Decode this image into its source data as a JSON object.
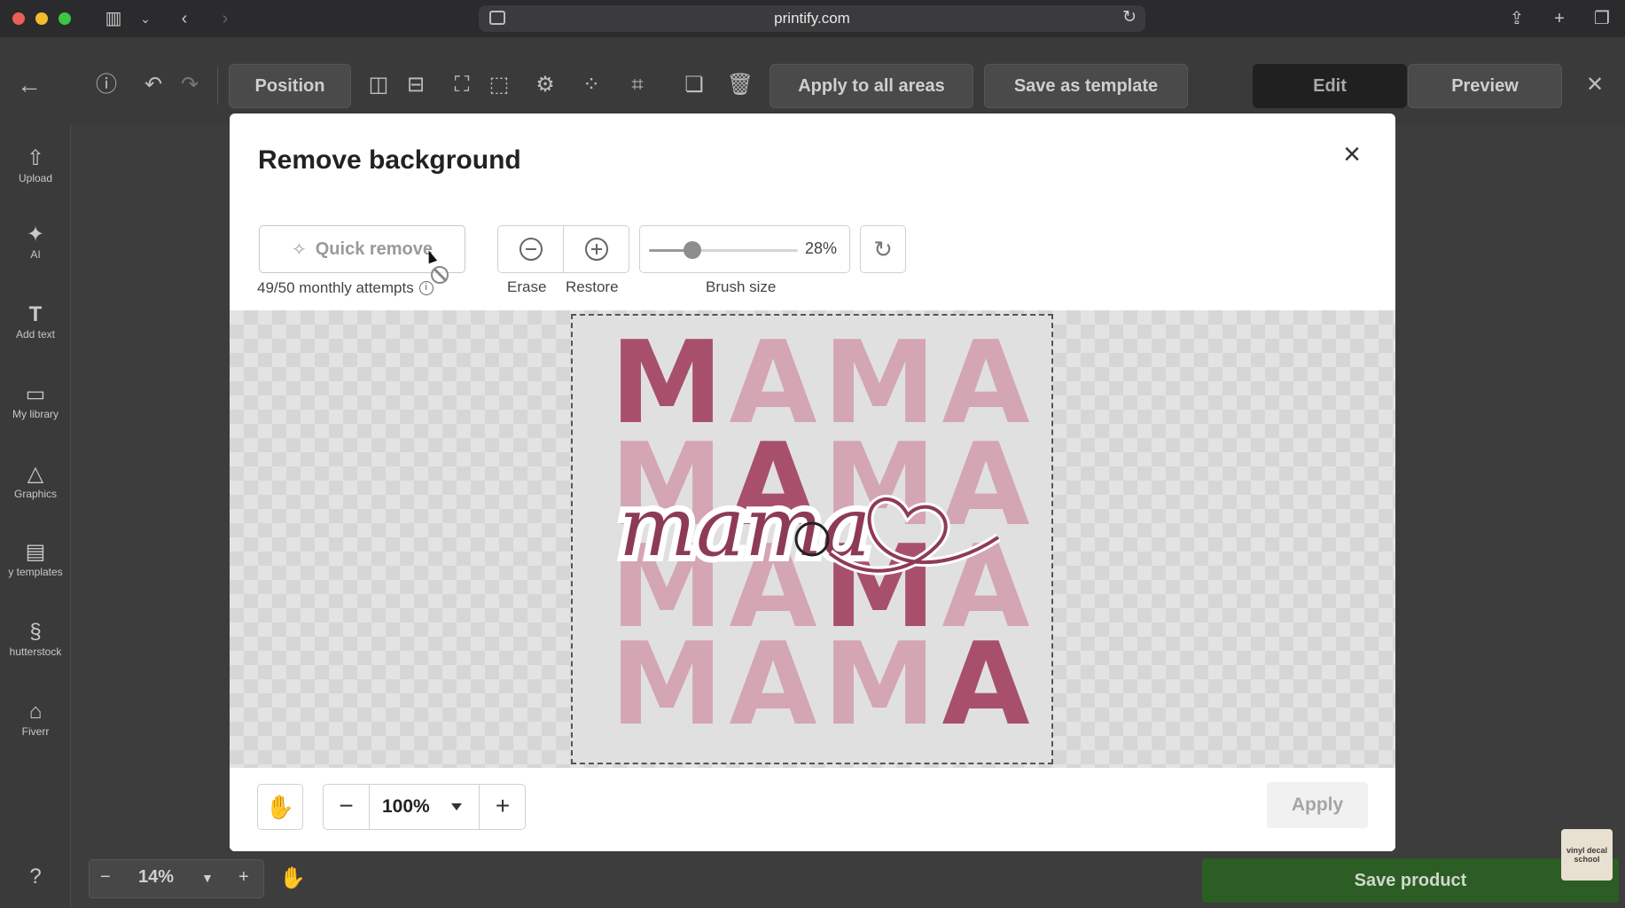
{
  "browser": {
    "url": "printify.com"
  },
  "toolbar": {
    "position_label": "Position",
    "apply_all_label": "Apply to all areas",
    "save_template_label": "Save as template",
    "edit_label": "Edit",
    "preview_label": "Preview"
  },
  "sidebar": {
    "items": [
      {
        "label": "Upload",
        "icon": "upload-icon"
      },
      {
        "label": "AI",
        "icon": "sparkle-icon"
      },
      {
        "label": "Add text",
        "icon": "text-icon"
      },
      {
        "label": "My library",
        "icon": "folder-icon"
      },
      {
        "label": "Graphics",
        "icon": "shapes-icon"
      },
      {
        "label": "y templates",
        "icon": "templates-icon"
      },
      {
        "label": "hutterstock",
        "icon": "shutterstock-icon"
      },
      {
        "label": "Fiverr",
        "icon": "fiverr-icon"
      }
    ]
  },
  "canvas_controls": {
    "zoom": "14%"
  },
  "save_product_label": "Save product",
  "watermark_text": "vinyl decal school",
  "modal": {
    "title": "Remove background",
    "quick_remove_label": "Quick remove",
    "attempts_label": "49/50 monthly attempts",
    "erase_label": "Erase",
    "restore_label": "Restore",
    "brush_size_label": "Brush size",
    "brush_size_value": "28%",
    "brush_size_percent": 28,
    "zoom_value": "100%",
    "apply_label": "Apply"
  },
  "design": {
    "row1": [
      "M",
      "A",
      "M",
      "A"
    ],
    "row2": [
      "M",
      "A",
      "M",
      "A"
    ],
    "row3": [
      "M",
      "A",
      "M",
      "A"
    ],
    "row4": [
      "M",
      "A",
      "M",
      "A"
    ],
    "script_text": "mama",
    "colors": {
      "light_pink": "#d4a5b3",
      "dark_pink": "#a8506b",
      "script": "#8d3a58"
    }
  },
  "colors": {
    "save_green": "#2c5d24",
    "edit_dark": "#202020"
  }
}
